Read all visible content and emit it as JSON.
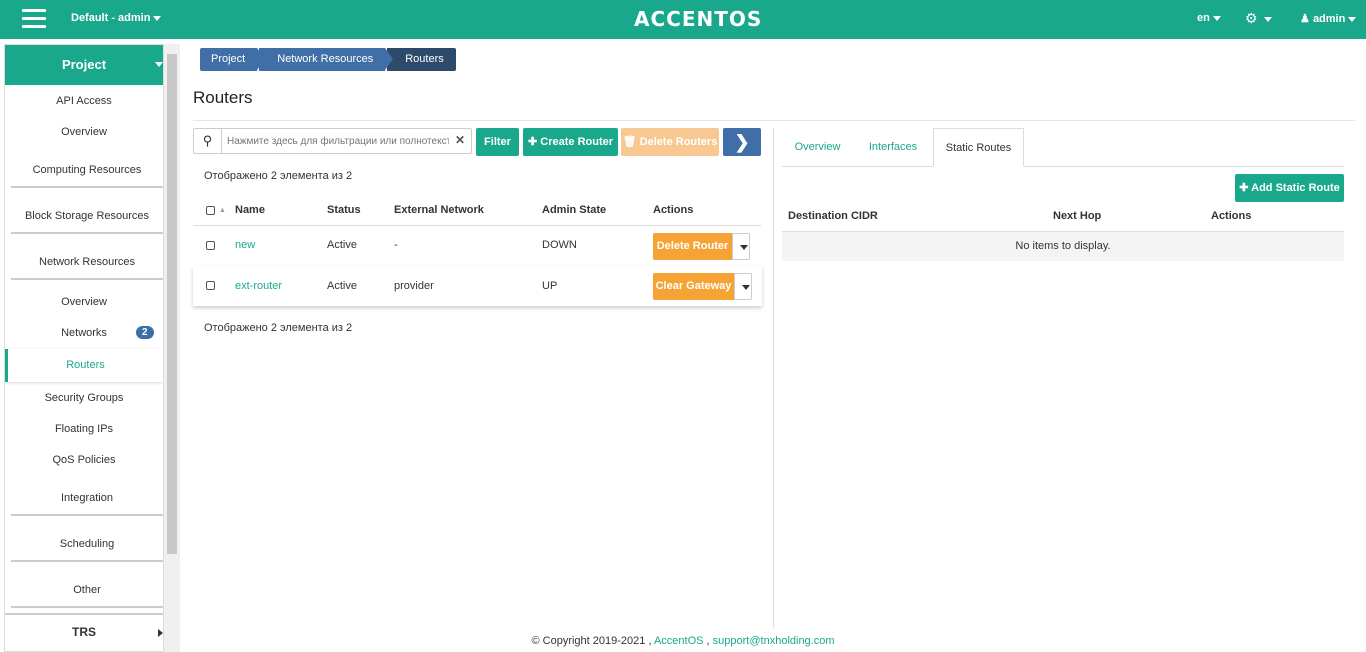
{
  "topbar": {
    "project_selector": "Default - admin",
    "logo": "ACCENTOS",
    "language": "en",
    "user": "admin"
  },
  "sidebar": {
    "project": "Project",
    "items": {
      "api_access": "API Access",
      "overview": "Overview",
      "computing": "Computing Resources",
      "block_storage": "Block Storage Resources",
      "network_resources": "Network Resources",
      "net_overview": "Overview",
      "networks": "Networks",
      "networks_count": "2",
      "routers": "Routers",
      "security_groups": "Security Groups",
      "floating_ips": "Floating IPs",
      "qos_policies": "QoS Policies",
      "integration": "Integration",
      "scheduling": "Scheduling",
      "other": "Other",
      "trs": "TRS"
    }
  },
  "breadcrumb": [
    "Project",
    "Network Resources",
    "Routers"
  ],
  "page_title": "Routers",
  "toolbar": {
    "search_placeholder": "Нажмите здесь для фильтрации или полнотекстового поиска",
    "filter": "Filter",
    "create": "Create Router",
    "delete": "Delete Routers"
  },
  "table": {
    "count_text": "Отображено 2 элемента из 2",
    "headers": [
      "Name",
      "Status",
      "External Network",
      "Admin State",
      "Actions"
    ],
    "rows": [
      {
        "name": "new",
        "status": "Active",
        "external_network": "-",
        "admin_state": "DOWN",
        "action": "Delete Router"
      },
      {
        "name": "ext-router",
        "status": "Active",
        "external_network": "provider",
        "admin_state": "UP",
        "action": "Clear Gateway"
      }
    ]
  },
  "detail": {
    "tabs": [
      "Overview",
      "Interfaces",
      "Static Routes"
    ],
    "active_tab": "Static Routes",
    "add_button": "Add Static Route",
    "headers": [
      "Destination CIDR",
      "Next Hop",
      "Actions"
    ],
    "empty_text": "No items to display."
  },
  "footer": {
    "copyright": "© Copyright 2019-2021 ,",
    "brand": "AccentOS",
    "sep": ",",
    "email": "support@tnxholding.com"
  },
  "colors": {
    "primary": "#1aa88c",
    "blue": "#3f6fa6",
    "orange": "#f5a335"
  }
}
